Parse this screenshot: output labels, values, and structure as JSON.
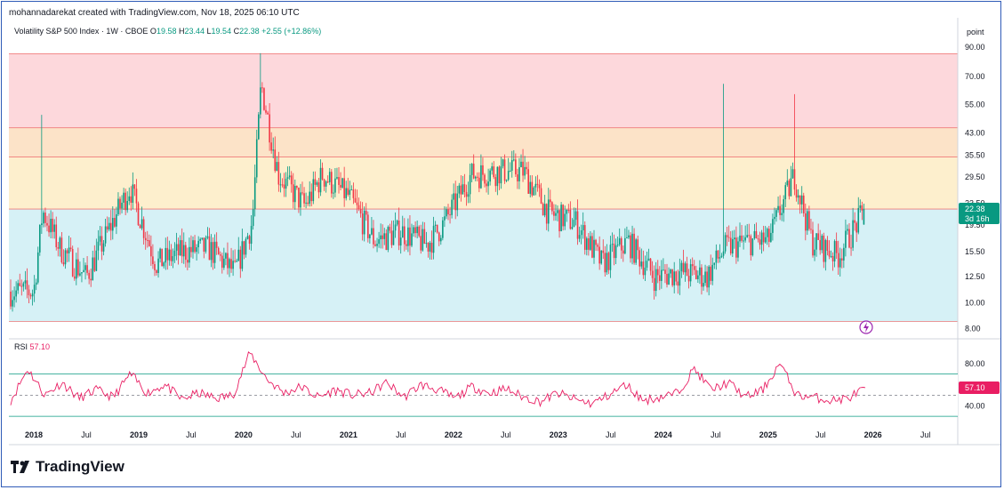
{
  "header": {
    "text": "mohannadarekat created with TradingView.com, Nov 18, 2025 06:10 UTC"
  },
  "legend": {
    "symbol": "Volatility S&P 500 Index · 1W · CBOE",
    "o_key": "O",
    "o_val": "19.58",
    "h_key": "H",
    "h_val": "23.44",
    "l_key": "L",
    "l_val": "19.54",
    "c_key": "C",
    "c_val": "22.38",
    "change": "+2.55 (+12.86%)"
  },
  "scale_mode": "point",
  "price_tag": {
    "value": "22.38",
    "countdown": "3d 16h"
  },
  "rsi": {
    "label": "RSI",
    "value": "57.10",
    "axis": [
      "80.00",
      "40.00"
    ],
    "overbought": 70,
    "oversold": 30,
    "mid": 50
  },
  "brand": {
    "name": "TradingView"
  },
  "colors": {
    "up": "#089981",
    "down": "#f23645",
    "rsi_line": "#e91e63",
    "zone_red": "#fdd8dc",
    "zone_orange": "#fce3c8",
    "zone_yellow": "#fdefcd",
    "zone_blue": "#d6f1f6"
  },
  "chart_data": [
    {
      "type": "candlestick",
      "title": "Volatility S&P 500 Index",
      "interval": "1W",
      "scale": "log",
      "ylim": [
        7.5,
        95
      ],
      "y_ticks": [
        "90.00",
        "70.00",
        "55.00",
        "43.00",
        "35.50",
        "29.50",
        "23.50",
        "19.50",
        "15.50",
        "12.50",
        "10.00",
        "8.00"
      ],
      "x_ticks": [
        "2018",
        "Jul",
        "2019",
        "Jul",
        "2020",
        "Jul",
        "2021",
        "Jul",
        "2022",
        "Jul",
        "2023",
        "Jul",
        "2024",
        "Jul",
        "2025",
        "Jul",
        "2026",
        "Jul"
      ],
      "zones": [
        {
          "from": 45,
          "to": 85,
          "color": "red"
        },
        {
          "from": 35,
          "to": 45,
          "color": "orange"
        },
        {
          "from": 22.38,
          "to": 35,
          "color": "yellow"
        },
        {
          "from": 8.5,
          "to": 22.38,
          "color": "blue"
        }
      ],
      "weekly_closes_sampled": [
        {
          "x": "2018-01",
          "close": 11.0
        },
        {
          "x": "2018-02",
          "close": 22.0
        },
        {
          "x": "2018-04",
          "close": 16.0
        },
        {
          "x": "2018-07",
          "close": 12.5
        },
        {
          "x": "2018-10",
          "close": 20.0
        },
        {
          "x": "2018-12",
          "close": 27.0
        },
        {
          "x": "2019-03",
          "close": 14.0
        },
        {
          "x": "2019-06",
          "close": 15.5
        },
        {
          "x": "2019-09",
          "close": 16.0
        },
        {
          "x": "2019-12",
          "close": 13.0
        },
        {
          "x": "2020-02",
          "close": 20.0
        },
        {
          "x": "2020-03",
          "close": 66.0
        },
        {
          "x": "2020-05",
          "close": 30.0
        },
        {
          "x": "2020-08",
          "close": 23.0
        },
        {
          "x": "2020-10",
          "close": 30.0
        },
        {
          "x": "2021-01",
          "close": 25.0
        },
        {
          "x": "2021-04",
          "close": 17.0
        },
        {
          "x": "2021-07",
          "close": 18.5
        },
        {
          "x": "2021-10",
          "close": 16.5
        },
        {
          "x": "2021-12",
          "close": 20.0
        },
        {
          "x": "2022-03",
          "close": 30.0
        },
        {
          "x": "2022-06",
          "close": 31.0
        },
        {
          "x": "2022-09",
          "close": 31.0
        },
        {
          "x": "2022-12",
          "close": 21.5
        },
        {
          "x": "2023-03",
          "close": 20.0
        },
        {
          "x": "2023-06",
          "close": 14.0
        },
        {
          "x": "2023-09",
          "close": 17.0
        },
        {
          "x": "2023-12",
          "close": 12.5
        },
        {
          "x": "2024-03",
          "close": 13.0
        },
        {
          "x": "2024-06",
          "close": 12.5
        },
        {
          "x": "2024-08",
          "close": 16.0
        },
        {
          "x": "2024-11",
          "close": 17.0
        },
        {
          "x": "2025-01",
          "close": 17.0
        },
        {
          "x": "2025-04",
          "close": 30.0
        },
        {
          "x": "2025-06",
          "close": 17.0
        },
        {
          "x": "2025-09",
          "close": 15.0
        },
        {
          "x": "2025-11",
          "close": 22.38
        }
      ],
      "spikes": [
        {
          "x": "2018-02",
          "high": 50.3
        },
        {
          "x": "2020-03",
          "high": 85.5
        },
        {
          "x": "2024-08",
          "high": 65.7
        },
        {
          "x": "2025-04",
          "high": 60.1
        }
      ],
      "last": {
        "open": 19.58,
        "high": 23.44,
        "low": 19.54,
        "close": 22.38
      }
    },
    {
      "type": "line",
      "title": "RSI",
      "ylim": [
        20,
        100
      ],
      "y_ticks": [
        "80.00",
        "40.00"
      ],
      "series": [
        {
          "name": "RSI",
          "values": [
            45,
            75,
            50,
            62,
            47,
            55,
            48,
            70,
            52,
            60,
            46,
            52,
            47,
            50,
            90,
            65,
            52,
            58,
            48,
            55,
            50,
            52,
            62,
            48,
            60,
            55,
            47,
            58,
            52,
            56,
            48,
            44,
            52,
            46,
            42,
            50,
            60,
            45,
            48,
            52,
            75,
            55,
            62,
            48,
            55,
            80,
            50,
            48,
            45,
            47,
            57.1
          ]
        }
      ]
    }
  ]
}
